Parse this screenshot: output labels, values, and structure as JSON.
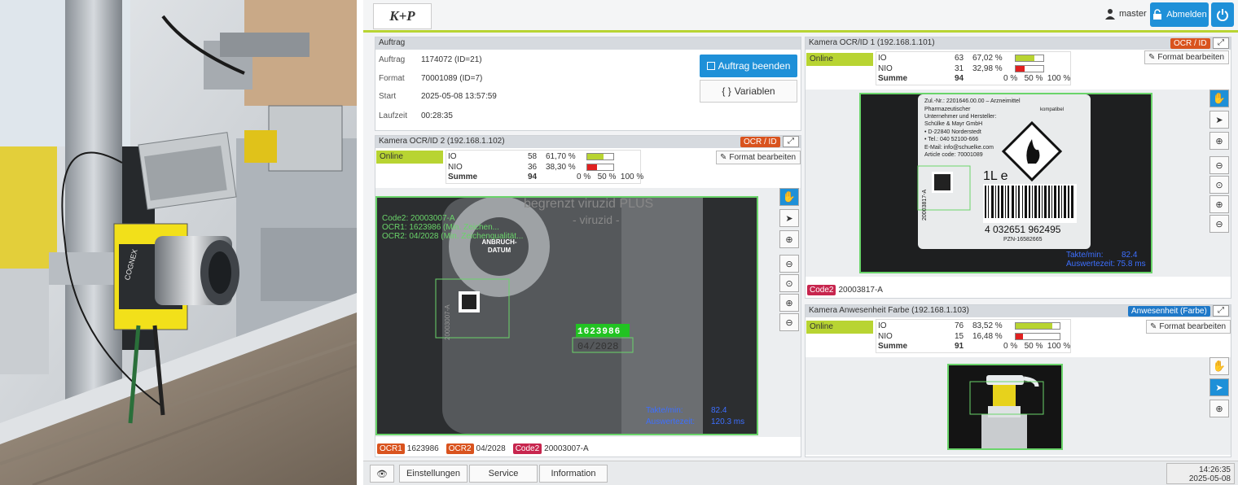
{
  "header": {
    "logo_text": "K+P",
    "user": "master",
    "logout_label": "Abmelden"
  },
  "auftrag": {
    "title": "Auftrag",
    "rows": [
      {
        "label": "Auftrag",
        "value": "1174072 (ID=21)"
      },
      {
        "label": "Format",
        "value": "70001089 (ID=7)"
      },
      {
        "label": "Start",
        "value": "2025-05-08 13:57:59"
      },
      {
        "label": "Laufzeit",
        "value": "00:28:35"
      }
    ],
    "end_button": "Auftrag beenden",
    "variables_button": "Variablen"
  },
  "cam2": {
    "title": "Kamera OCR/ID 2 (192.168.1.102)",
    "tag": "OCR / ID",
    "status": "Online",
    "io_label": "IO",
    "io_count": "58",
    "io_pct": "61,70 %",
    "io_fraction": 0.617,
    "nio_label": "NIO",
    "nio_count": "36",
    "nio_pct": "38,30 %",
    "nio_fraction": 0.383,
    "sum_label": "Summe",
    "sum_count": "94",
    "scale": "0 %   50 %  100 %",
    "format_button": "Format bearbeiten",
    "overlay": {
      "line1": "Code2: 20003007-A",
      "line2": "OCR1: 1623986 (Min. Zeichen...",
      "line3": "OCR2: 04/2028 (Min. Zeichenqualität...",
      "takte_label": "Takte/min:",
      "takte_value": "82.4",
      "ausw_label": "Auswertezeit:",
      "ausw_value": "120.3 ms",
      "sticker_top": "ANBRUCH-",
      "sticker_bottom": "DATUM",
      "product_text": "begrenzt viruzid PLUS",
      "product_text2": "- viruzid -",
      "ocr_digits": "1623986",
      "ocr_date": "04/2028",
      "dm_code": "20003007-A"
    },
    "results": [
      {
        "tag": "OCR1",
        "value": "1623986",
        "color": "#d9531e"
      },
      {
        "tag": "OCR2",
        "value": "04/2028",
        "color": "#d9531e"
      },
      {
        "tag": "Code2",
        "value": "20003007-A",
        "color": "#c7254e"
      }
    ]
  },
  "cam1": {
    "title": "Kamera OCR/ID 1 (192.168.1.101)",
    "tag": "OCR / ID",
    "status": "Online",
    "io_label": "IO",
    "io_count": "63",
    "io_pct": "67,02 %",
    "io_fraction": 0.6702,
    "nio_label": "NIO",
    "nio_count": "31",
    "nio_pct": "32,98 %",
    "nio_fraction": 0.3298,
    "sum_label": "Summe",
    "sum_count": "94",
    "scale": "0 %   50 %  100 %",
    "format_button": "Format bearbeiten",
    "overlay": {
      "label_line1": "Zul.-Nr.: 2201646.00.00 – Arzneimittel",
      "label_line2": "Pharmazeutischer",
      "label_line3": "Unternehmer und Hersteller:",
      "label_line4": "Schülke & Mayr GmbH",
      "label_line5": "• D-22840 Norderstedt",
      "label_line6": "• Tel.: 040 52100-666",
      "label_line7": "E-Mail: info@schuelke.com",
      "label_line8": "Article code: 70001089",
      "volume": "1L e",
      "barcode_number": "4 032651 962495",
      "pzn": "PZN-16582665",
      "dm_code": "20003817-A",
      "compat": "kompatibel",
      "takte_label": "Takte/min:",
      "takte_value": "82.4",
      "ausw_label": "Auswertezeit:",
      "ausw_value": "75.8 ms"
    },
    "results": [
      {
        "tag": "Code2",
        "value": "20003817-A",
        "color": "#c7254e"
      }
    ]
  },
  "cam3": {
    "title": "Kamera Anwesenheit Farbe (192.168.1.103)",
    "tag": "Anwesenheit (Farbe)",
    "status": "Online",
    "io_label": "IO",
    "io_count": "76",
    "io_pct": "83,52 %",
    "io_fraction": 0.8352,
    "nio_label": "NIO",
    "nio_count": "15",
    "nio_pct": "16,48 %",
    "nio_fraction": 0.1648,
    "sum_label": "Summe",
    "sum_count": "91",
    "scale": "0 %   50 %  100 %",
    "format_button": "Format bearbeiten"
  },
  "photo": {
    "brand": "COGNEX"
  },
  "footer": {
    "buttons": [
      "Einstellungen",
      "Service",
      "Information"
    ],
    "time": "14:26:35",
    "date": "2025-05-08"
  },
  "colors": {
    "accent": "#1e90d8",
    "online": "#b8d432",
    "nio_bar": "#e02020",
    "tag_orange": "#d9531e",
    "tag_blue": "#1e78c8"
  }
}
